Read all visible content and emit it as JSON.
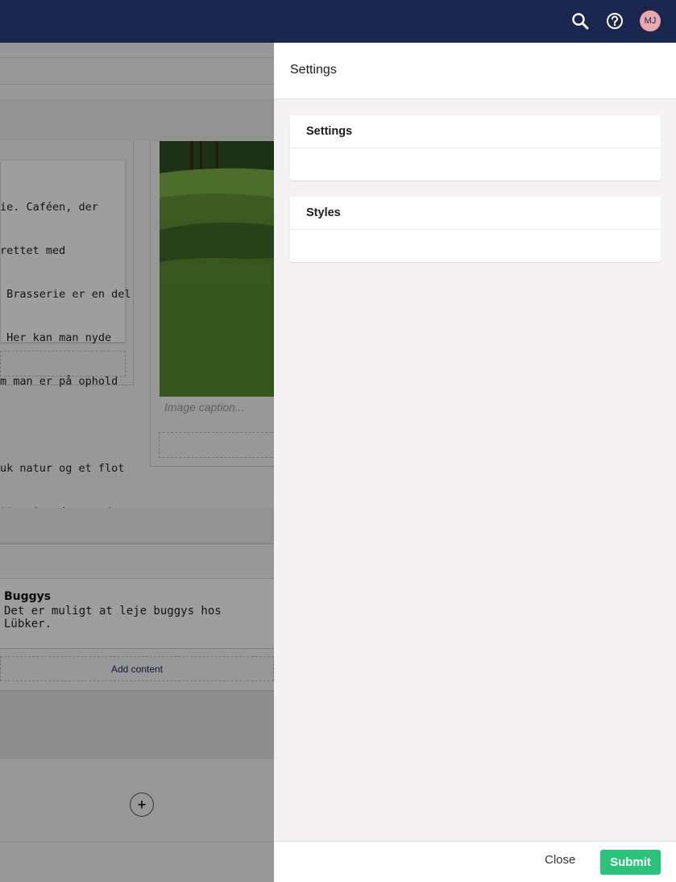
{
  "topbar": {
    "icons": [
      "search-icon",
      "help-icon"
    ],
    "avatar_initials": "MJ"
  },
  "editor": {
    "paragraph_lines": [
      "ie. Caféen, der",
      "rettet med",
      " Brasserie er en del",
      " Her kan man nyde",
      "m man er på ophold",
      "",
      "uk natur og et flot",
      "tte sig ud og nyde"
    ],
    "image_caption_placeholder": "Image caption...",
    "feature_title": "Buggys",
    "feature_text": "Det er muligt at leje buggys hos Lübker.",
    "add_content_label": "Add content",
    "add_row_icon": "plus-icon"
  },
  "panel": {
    "title": "Settings",
    "sections": [
      {
        "title": "Settings"
      },
      {
        "title": "Styles"
      }
    ],
    "close_label": "Close",
    "submit_label": "Submit"
  },
  "colors": {
    "topbar": "#1b264f",
    "submit": "#2bc37c",
    "avatar": "#e9a9ae"
  }
}
